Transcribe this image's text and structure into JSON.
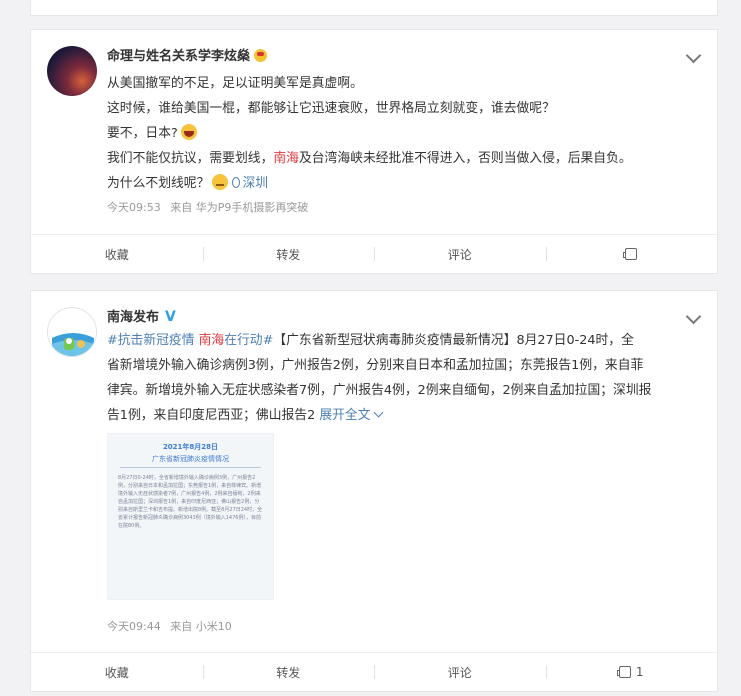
{
  "post1": {
    "username": "命理与姓名关系学李炫燊",
    "lines": [
      "从美国撤军的不足，足以证明美军是真虚啊。",
      "这时候，谁给美国一棍，都能够让它迅速衰败，世界格局立刻就变，谁去做呢？",
      "要不，日本?",
      "我们不能仅抗议，需要划线，",
      "南海",
      "及台湾海峡未经批准不得进入，否则当做入侵，后果自负。",
      "为什么不划线呢？",
      "深圳"
    ],
    "meta_time": "今天09:53",
    "meta_from": "来自 华为P9手机摄影再突破",
    "actions": {
      "collect": "收藏",
      "repost": "转发",
      "comment": "评论",
      "like": ""
    }
  },
  "post2": {
    "username": "南海发布",
    "avatar_text": "南海发布",
    "avatar_sub": "NANHAI NEWS",
    "hashtag1": "#抗击新冠疫情",
    "hashtag2_red": "南海",
    "hashtag2_rest": "在行动#",
    "line1_rest": "【广东省新型冠状病毒肺炎疫情最新情况】8月27日0-24时，全",
    "line2": "省新增境外输入确诊病例3例，广州报告2例，分别来自日本和孟加拉国；东莞报告1例，来自菲",
    "line3": "律宾。新增境外输入无症状感染者7例，广州报告4例，2例来自缅甸，2例来自孟加拉国；深圳报",
    "line4": "告1例，来自印度尼西亚；佛山报告2",
    "expand": "展开全文",
    "image": {
      "title1": "2021年8月28日",
      "title2": "广东省新冠肺炎疫情情况",
      "body": "8月27日0-24时，全省新增境外输入确诊病例3例，广州报告2例，分别来自日本和孟加拉国；东莞报告1例，来自菲律宾。新增境外输入无症状感染者7例，广州报告4例，2例来自缅甸，2例来自孟加拉国；深圳报告1例，来自印度尼西亚；佛山报告2例，分别来自斯里兰卡和吉布提。新增出院8例。截至8月27日24时，全省累计报告新冠肺炎确诊病例3043例（境外输入1476例），目前在院80例。",
      "watermark": ""
    },
    "meta_time": "今天09:44",
    "meta_from": "来自 小米10",
    "actions": {
      "collect": "收藏",
      "repost": "转发",
      "comment": "评论",
      "like": "1"
    }
  },
  "colors": {
    "link": "#4a7fb6",
    "red": "#e5383b",
    "verified": "#2aa0e6"
  }
}
